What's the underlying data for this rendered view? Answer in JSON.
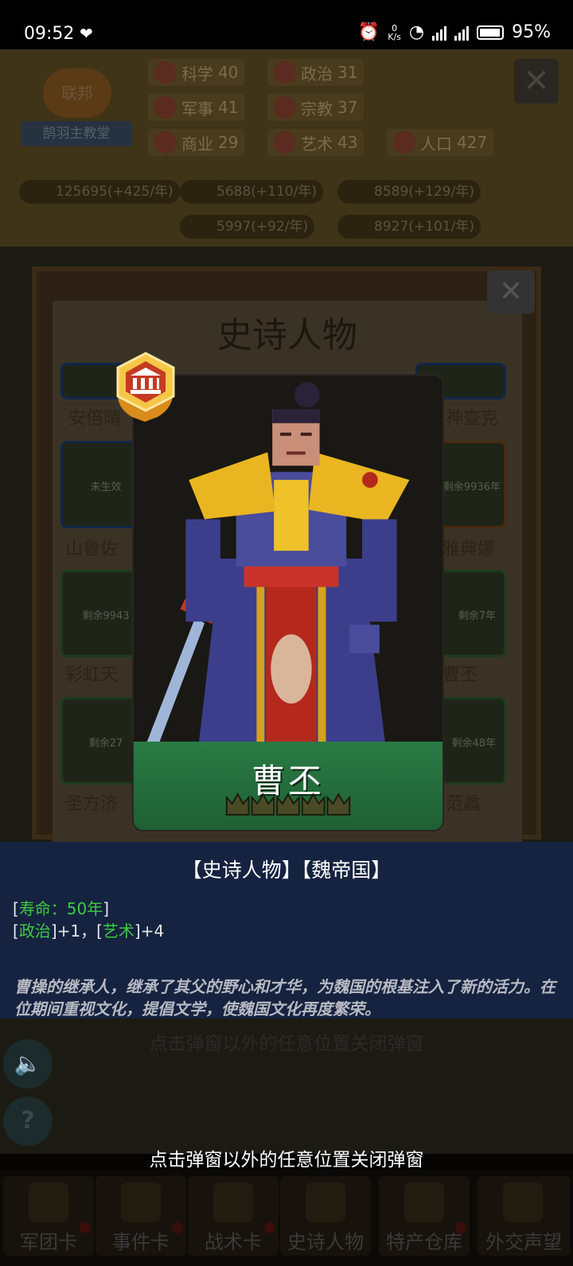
{
  "status_bar": {
    "time": "09:52",
    "net_speed_value": "0",
    "net_speed_unit": "K/s",
    "battery": "95%"
  },
  "hud": {
    "faction_badge": "联邦",
    "faction_name": "鹄羽主教堂",
    "stats": [
      {
        "label": "科学",
        "value": "40"
      },
      {
        "label": "政治",
        "value": "31"
      },
      {
        "label": "军事",
        "value": "41"
      },
      {
        "label": "宗教",
        "value": "37"
      },
      {
        "label": "商业",
        "value": "29"
      },
      {
        "label": "艺术",
        "value": "43"
      },
      {
        "label": "人口",
        "value": "427"
      }
    ],
    "resources": [
      "125695(+425/年)",
      "5688(+110/年)",
      "8589(+129/年)",
      "5997(+92/年)",
      "8927(+101/年)"
    ]
  },
  "dialog": {
    "title": "史诗人物",
    "grid_names": [
      "安倍晴",
      "神查克",
      "山鲁佐",
      "雅典娜",
      "彩虹天",
      "曹丕",
      "圣方济",
      "范蠡"
    ],
    "grid_status": [
      "未生效",
      "剩余9936年",
      "剩余9943",
      "剩余7年",
      "剩余27",
      "剩余48年"
    ]
  },
  "card": {
    "name": "曹丕",
    "stars": 5,
    "accent": "#2a7b45"
  },
  "detail": {
    "title": "【史诗人物】【魏帝国】",
    "lifespan_open": "[",
    "lifespan": "寿命：50年",
    "lifespan_close": "]",
    "effect_open1": "[",
    "effect_attr1": "政治",
    "effect_val1": "]+1，",
    "effect_open2": "[",
    "effect_attr2": "艺术",
    "effect_val2": "]+4",
    "bio": "曹操的继承人，继承了其父的野心和才华，为魏国的根基注入了新的活力。在位期间重视文化，提倡文学，使魏国文化再度繁荣。"
  },
  "close_hint": "点击弹窗以外的任意位置关闭弹窗",
  "nav": [
    {
      "label": "军团卡"
    },
    {
      "label": "事件卡"
    },
    {
      "label": "战术卡"
    },
    {
      "label": "史诗人物"
    },
    {
      "label": "特产仓库"
    },
    {
      "label": "外交声望"
    }
  ]
}
